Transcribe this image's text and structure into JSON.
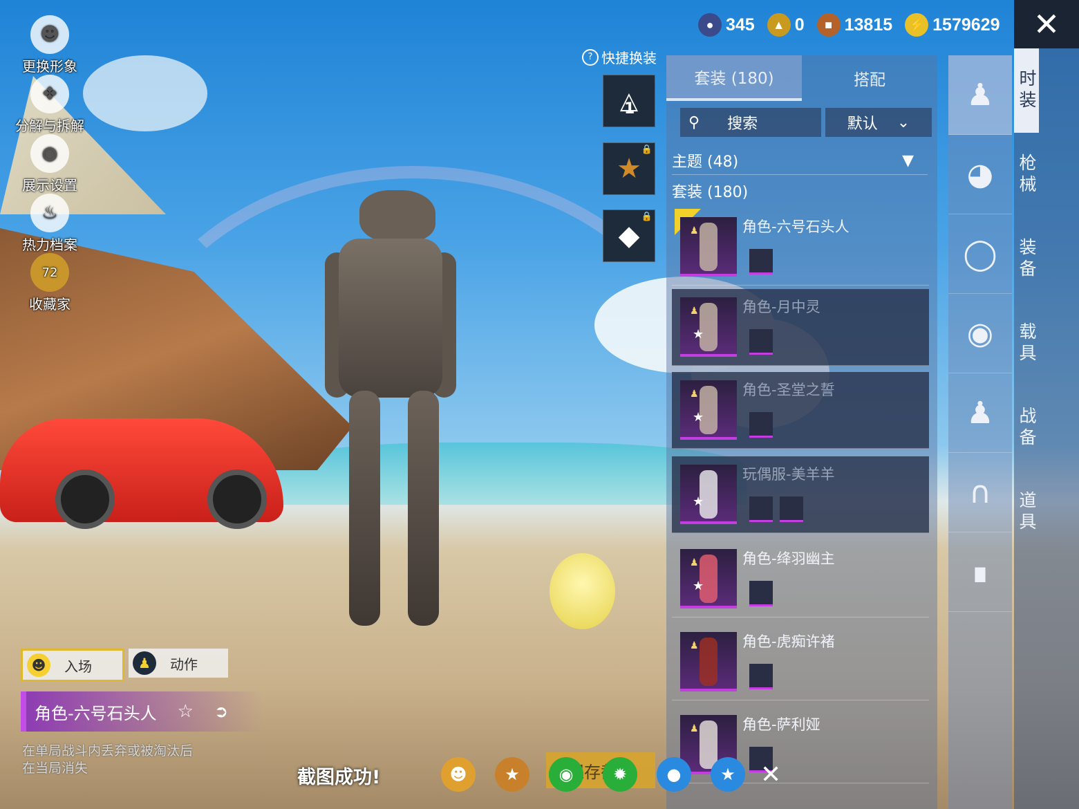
{
  "left_menu": [
    {
      "label": "更换形象",
      "icon": "avatar-icon"
    },
    {
      "label": "分解与拆解",
      "icon": "puzzle-icon"
    },
    {
      "label": "展示设置",
      "icon": "eye-icon"
    },
    {
      "label": "热力档案",
      "icon": "flame-icon"
    },
    {
      "label": "收藏家",
      "icon": "collector-badge-icon",
      "badge": "72"
    }
  ],
  "currencies": [
    {
      "value": "345",
      "icon": "token-icon",
      "color": "#3a4a8a"
    },
    {
      "value": "0",
      "icon": "gold-emblem-icon",
      "color": "#c99a20"
    },
    {
      "value": "13815",
      "icon": "bronze-coin-icon",
      "color": "#b4622a"
    },
    {
      "value": "1579629",
      "icon": "lightning-coin-icon",
      "color": "#e8c028"
    }
  ],
  "quick_change": {
    "label": "快捷换装",
    "slot1_number": "1"
  },
  "panel": {
    "tabs": [
      "套装 (180)",
      "搭配"
    ],
    "search_label": "搜索",
    "sort_label": "默认",
    "theme_label": "主题 (48)",
    "count_label": "套装 (180)",
    "items": [
      {
        "name": "角色-六号石头人",
        "selected": true,
        "dim": false,
        "star": false
      },
      {
        "name": "角色-月中灵",
        "selected": false,
        "dim": true,
        "star": true
      },
      {
        "name": "角色-圣堂之誓",
        "selected": false,
        "dim": true,
        "star": true
      },
      {
        "name": "玩偶服-美羊羊",
        "selected": false,
        "dim": true,
        "star": true
      },
      {
        "name": "角色-绛羽幽主",
        "selected": false,
        "dim": false,
        "star": true
      },
      {
        "name": "角色-虎痴许褚",
        "selected": false,
        "dim": false,
        "star": false
      },
      {
        "name": "角色-萨利娅",
        "selected": false,
        "dim": false,
        "star": false
      }
    ]
  },
  "categories": [
    "outfit-icon",
    "hat-icon",
    "glasses-icon",
    "mask-icon",
    "suit-icon",
    "pants-icon",
    "shoes-icon"
  ],
  "side_tabs": [
    "时装",
    "枪械",
    "装备",
    "载具",
    "战备",
    "道具"
  ],
  "actions": {
    "entry": "入场",
    "emote": "动作"
  },
  "current_outfit": "角色-六号石头人",
  "hint": [
    "在单局战斗内丢弃或被淘汰后",
    "在当局消失"
  ],
  "toast": "截图成功!",
  "share": {
    "save_label": "保存截图",
    "buttons": [
      {
        "icon": "contacts-icon",
        "color": "#e0a030"
      },
      {
        "icon": "game-elite-icon",
        "color": "#c8802a"
      },
      {
        "icon": "wechat-icon",
        "color": "#2aae3a"
      },
      {
        "icon": "moments-icon",
        "color": "#2aae3a"
      },
      {
        "icon": "qq-icon",
        "color": "#2a8ae0"
      },
      {
        "icon": "qzone-icon",
        "color": "#2a8ae0"
      }
    ]
  }
}
